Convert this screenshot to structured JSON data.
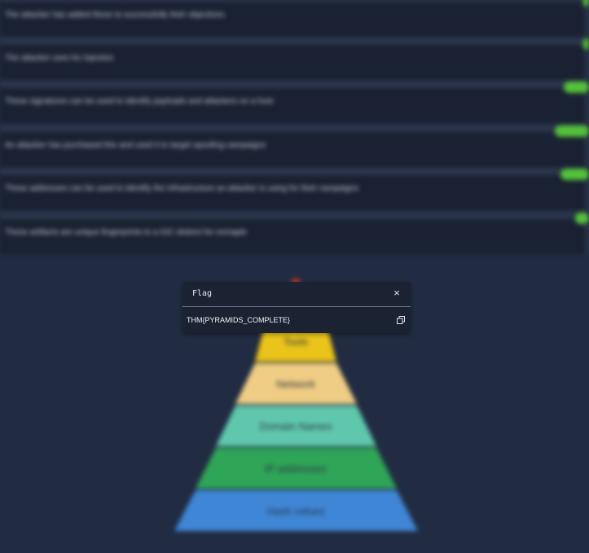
{
  "questions": [
    {
      "text": "The attacker has added these to successfully their objectives",
      "answered": false
    },
    {
      "text": "The attacker uses for injection",
      "answered": false
    },
    {
      "text": "These signatures can be used to identify payloads and attackers on a host",
      "answered": true
    },
    {
      "text": "An attacker has purchased this and used it to target spoofing campaigns",
      "answered": true
    },
    {
      "text": "These addresses can be used to identify the infrastructure an attacker is using for their campaigns",
      "answered": true
    },
    {
      "text": "These artifacts are unique fingerprints to a IOC distinct for exmaple",
      "answered": true
    }
  ],
  "pyramid": {
    "levels": [
      "Tools",
      "Network",
      "Domain Names",
      "IP addresses",
      "Hash values"
    ]
  },
  "colors": {
    "background": "#212c42",
    "panel": "#1a2132",
    "success_green": "#54c23a",
    "tools": "#eac41a",
    "network": "#f0cd84",
    "domain_names": "#5fc8ac",
    "ip_addresses": "#2fa558",
    "hash_values": "#3f86d6"
  },
  "flag_modal": {
    "title": "Flag",
    "close_glyph": "×",
    "value": "THM{PYRAMIDS_COMPLETE}",
    "copy_icon": "copy-icon"
  }
}
